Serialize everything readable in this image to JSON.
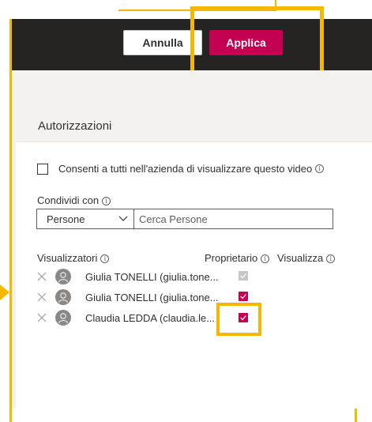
{
  "toolbar": {
    "cancel_label": "Annulla",
    "apply_label": "Applica"
  },
  "panel": {
    "title": "Autorizzazioni"
  },
  "allow_all": {
    "label": "Consenti a tutti nell'azienda di visualizzare questo video",
    "checked": false
  },
  "share": {
    "label": "Condividi con",
    "type_selected": "Persone",
    "search_placeholder": "Cerca Persone"
  },
  "columns": {
    "viewers": "Visualizzatori",
    "owner": "Proprietario",
    "view": "Visualizza"
  },
  "users": [
    {
      "name": "Giulia TONELLI (giulia.tone...",
      "owner_checked": true,
      "owner_enabled": false
    },
    {
      "name": "Giulia TONELLI (giulia.tone...",
      "owner_checked": true,
      "owner_enabled": true
    },
    {
      "name": "Claudia LEDDA (claudia.le...",
      "owner_checked": true,
      "owner_enabled": true
    }
  ],
  "colors": {
    "accent": "#c30052",
    "toolbar": "#252423",
    "highlight": "#f5b800"
  },
  "icons": [
    "info-icon",
    "chevron-down-icon",
    "close-icon",
    "person-icon",
    "checkmark-icon"
  ]
}
